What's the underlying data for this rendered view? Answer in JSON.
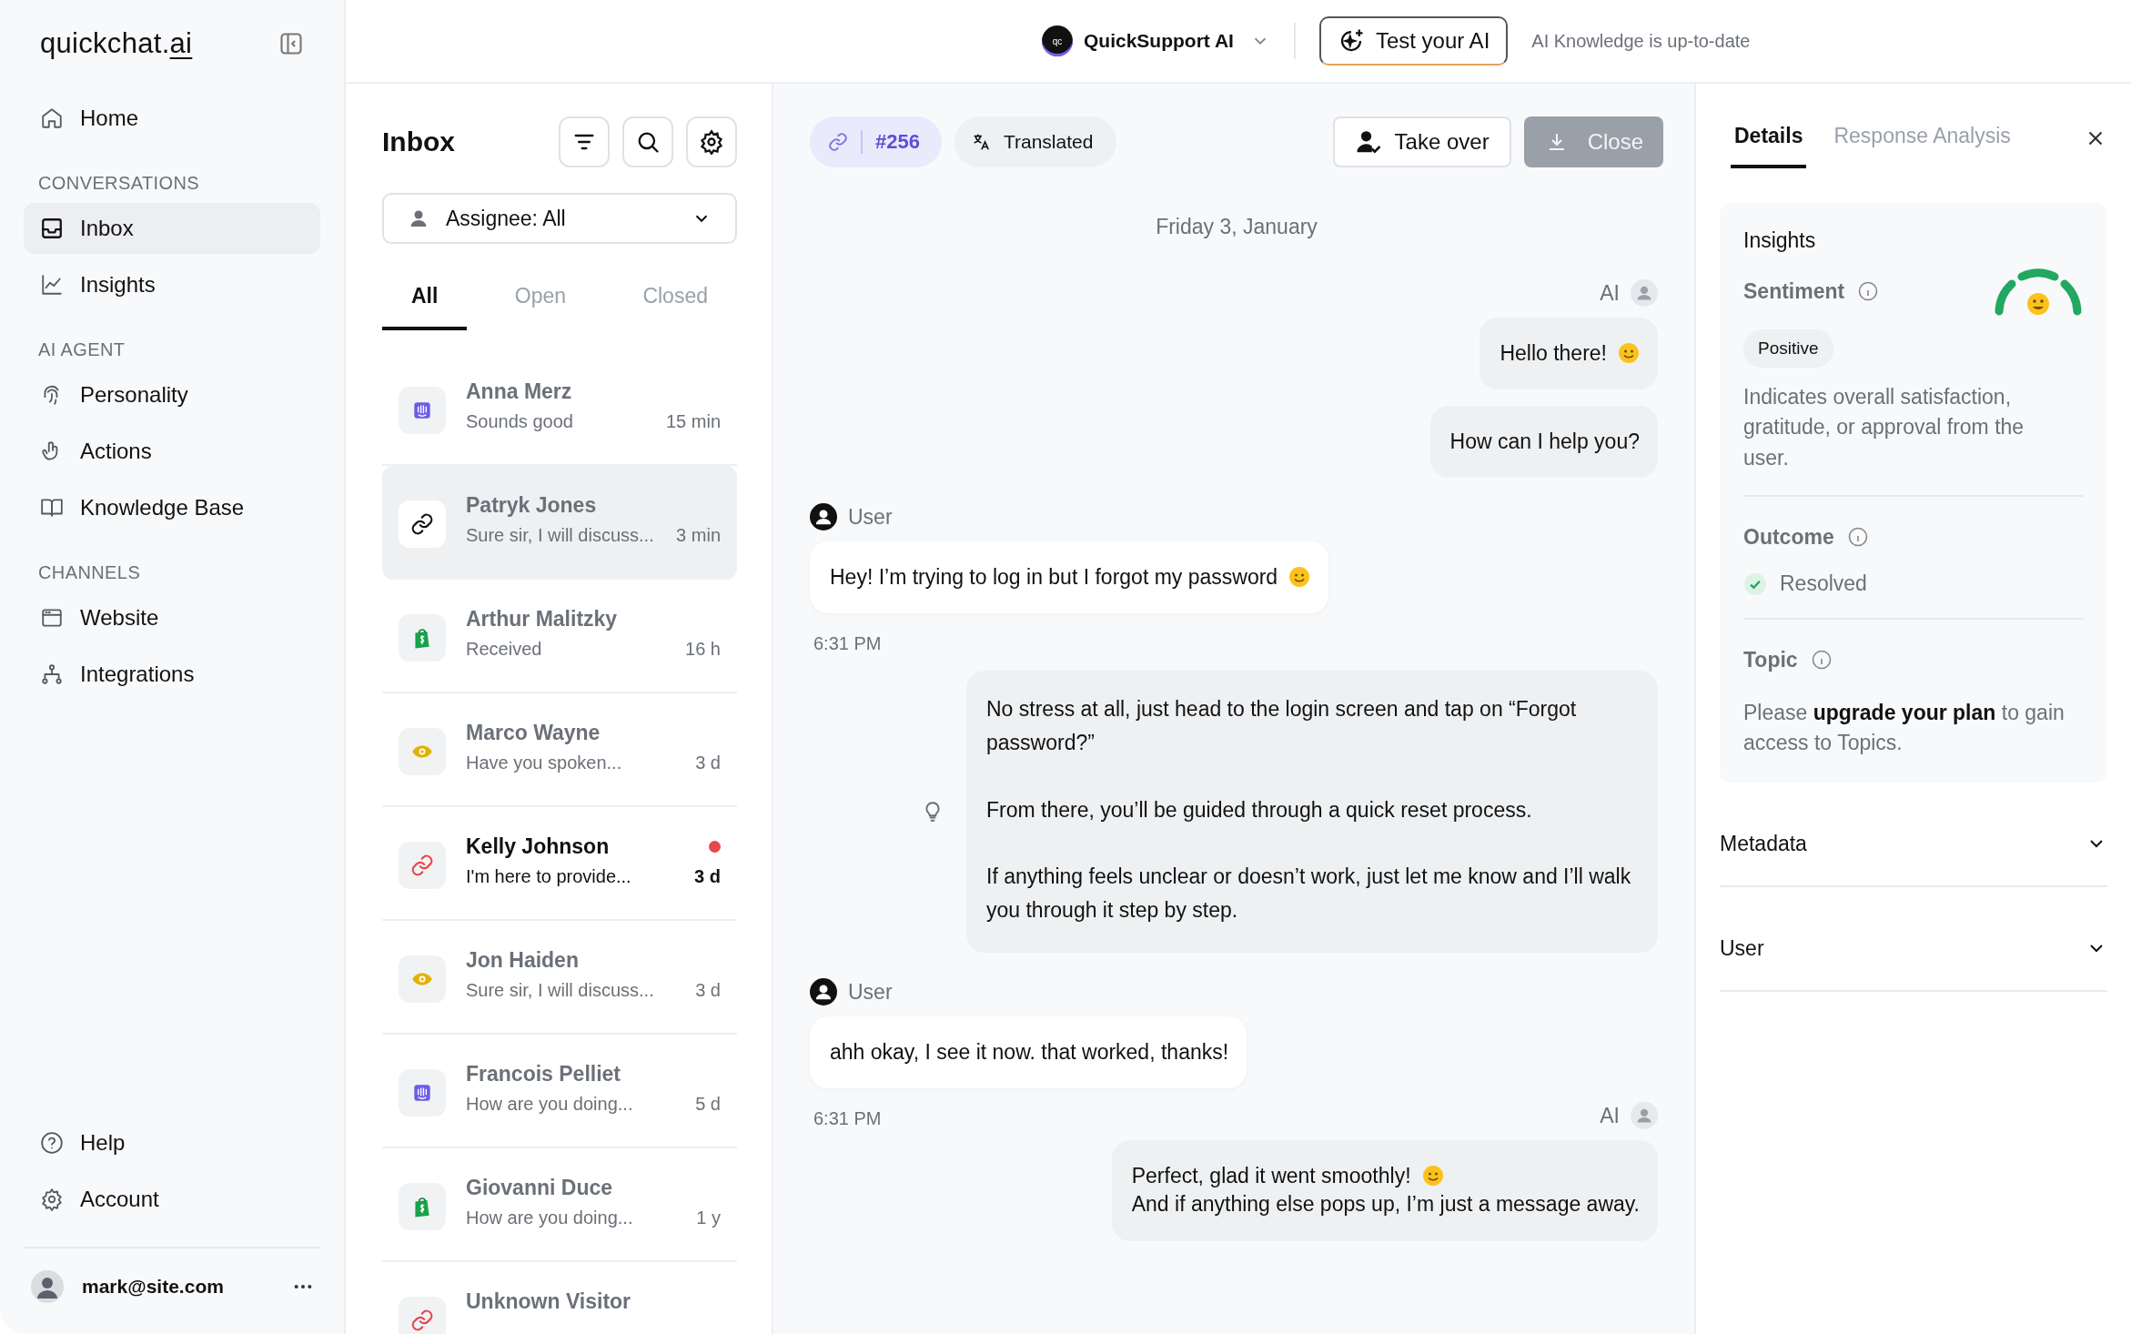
{
  "sidebar": {
    "logo_main": "quickchat.",
    "logo_accent": "ai",
    "sections": [
      {
        "items": [
          {
            "label": "Home",
            "kind": "home",
            "selected": false
          }
        ]
      },
      {
        "heading": "CONVERSATIONS",
        "items": [
          {
            "label": "Inbox",
            "kind": "inbox",
            "selected": true
          },
          {
            "label": "Insights",
            "kind": "chart",
            "selected": false
          }
        ]
      },
      {
        "heading": "AI AGENT",
        "items": [
          {
            "label": "Personality",
            "kind": "fingerprint",
            "selected": false
          },
          {
            "label": "Actions",
            "kind": "hand",
            "selected": false
          },
          {
            "label": "Knowledge Base",
            "kind": "book",
            "selected": false
          }
        ]
      },
      {
        "heading": "CHANNELS",
        "items": [
          {
            "label": "Website",
            "kind": "browser",
            "selected": false
          },
          {
            "label": "Integrations",
            "kind": "tree",
            "selected": false
          }
        ]
      }
    ],
    "bottom_items": [
      {
        "label": "Help",
        "kind": "help",
        "selected": false
      },
      {
        "label": "Account",
        "kind": "gear",
        "selected": false
      }
    ],
    "user_email": "mark@site.com"
  },
  "topbar": {
    "agent_logo": "qc",
    "agent_name": "QuickSupport AI",
    "test_button": "Test your AI",
    "status": "AI Knowledge is up-to-date"
  },
  "inbox": {
    "title": "Inbox",
    "assignee": "Assignee: All",
    "tabs": [
      {
        "label": "All",
        "selected": true
      },
      {
        "label": "Open",
        "selected": false
      },
      {
        "label": "Closed",
        "selected": false
      }
    ],
    "conversations": [
      {
        "name": "Anna Merz",
        "preview": "Sounds good",
        "time": "15 min",
        "kind": "intercom",
        "selected": false,
        "unread": false
      },
      {
        "name": "Patryk Jones",
        "preview": "Sure sir, I will discuss...",
        "time": "3 min",
        "kind": "link",
        "selected": true,
        "unread": false
      },
      {
        "name": "Arthur Malitzky",
        "preview": "Received",
        "time": "16 h",
        "kind": "shopify",
        "selected": false,
        "unread": false
      },
      {
        "name": "Marco Wayne",
        "preview": "Have you spoken...",
        "time": "3 d",
        "kind": "eye",
        "selected": false,
        "unread": false
      },
      {
        "name": "Kelly Johnson",
        "preview": "I'm here to provide...",
        "time": "3 d",
        "kind": "link",
        "selected": false,
        "unread": true
      },
      {
        "name": "Jon Haiden",
        "preview": "Sure sir, I will discuss...",
        "time": "3 d",
        "kind": "eye",
        "selected": false,
        "unread": false
      },
      {
        "name": "Francois Pelliet",
        "preview": "How are you doing...",
        "time": "5 d",
        "kind": "intercom",
        "selected": false,
        "unread": false
      },
      {
        "name": "Giovanni Duce",
        "preview": "How are you doing...",
        "time": "1 y",
        "kind": "shopify",
        "selected": false,
        "unread": false
      },
      {
        "name": "Unknown Visitor",
        "kind": "link",
        "selected": false,
        "unread": false
      }
    ]
  },
  "chat": {
    "ticket": "#256",
    "translated": "Translated",
    "take_over": "Take over",
    "close": "Close",
    "date": "Friday 3, January",
    "messages": [
      {
        "kind": "ai",
        "label": "AI",
        "hint": false,
        "spaced": false,
        "paragraphs": [
          {
            "text": "Hello there!",
            "emoji": true
          }
        ]
      },
      {
        "kind": "ai",
        "hint": false,
        "spaced": false,
        "paragraphs": [
          {
            "text": "How can I help you?",
            "emoji": false
          }
        ]
      },
      {
        "kind": "user",
        "label": "User",
        "time": "6:31 PM",
        "hint": false,
        "spaced": false,
        "paragraphs": [
          {
            "text": "Hey! I’m trying to log in but I forgot my password",
            "emoji": true
          }
        ]
      },
      {
        "kind": "ai",
        "hint": true,
        "spaced": true,
        "paragraphs": [
          {
            "text": "No stress at all, just head to the login screen and tap on “Forgot password?”",
            "emoji": false
          },
          {
            "text": "From there, you’ll be guided through a quick reset process.",
            "emoji": false
          },
          {
            "text": "If anything feels unclear or doesn’t work, just let me know and I’ll walk you through it step by step.",
            "emoji": false
          }
        ]
      },
      {
        "kind": "user",
        "label": "User",
        "time": "6:31 PM",
        "hint": false,
        "spaced": false,
        "paragraphs": [
          {
            "text": "ahh okay, I see it now. that worked, thanks!",
            "emoji": false
          }
        ]
      },
      {
        "kind": "ai",
        "label": "AI",
        "hint": false,
        "spaced": false,
        "paragraphs": [
          {
            "text": "Perfect, glad it went smoothly!",
            "emoji": true
          },
          {
            "text": "And if anything else pops up, I’m just a message away.",
            "emoji": false
          }
        ]
      }
    ]
  },
  "details": {
    "tabs": [
      {
        "label": "Details",
        "selected": true
      },
      {
        "label": "Response Analysis",
        "selected": false
      }
    ],
    "insights": {
      "title": "Insights",
      "sentiment_label": "Sentiment",
      "sentiment": "Positive",
      "sentiment_text": "Indicates overall satisfaction, gratitude, or approval from the user.",
      "outcome_label": "Outcome",
      "outcome": "Resolved",
      "topic_label": "Topic",
      "topic_text": "Please **upgrade your plan** to gain access to Topics."
    },
    "sections": [
      {
        "label": "Metadata",
        "expanded": false
      },
      {
        "label": "User",
        "expanded": false
      }
    ]
  }
}
